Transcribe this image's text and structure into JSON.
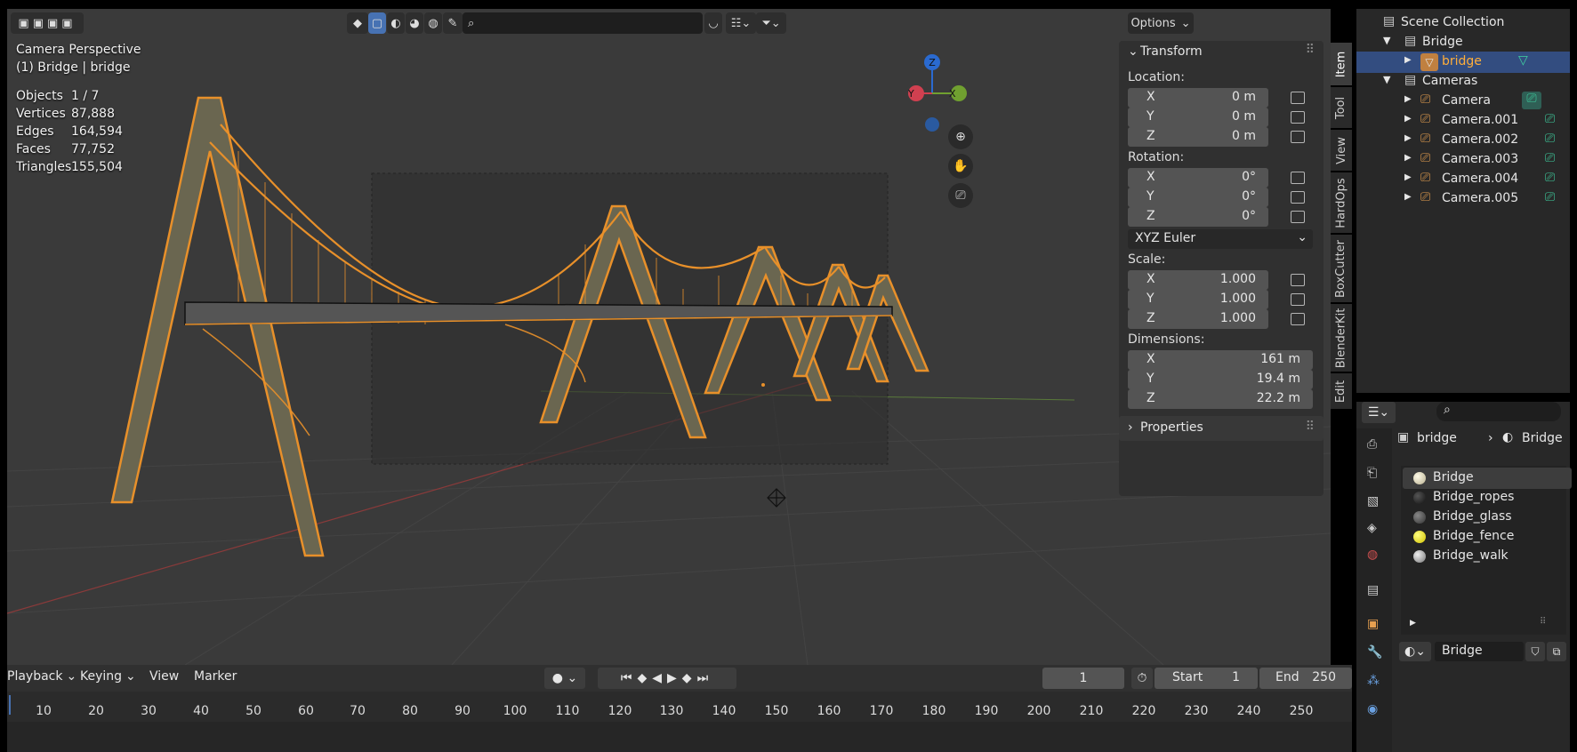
{
  "viewport": {
    "info_camera": "Camera Perspective",
    "info_object": "(1) Bridge | bridge",
    "stats": [
      {
        "label": "Objects",
        "value": "1 / 7"
      },
      {
        "label": "Vertices",
        "value": "87,888"
      },
      {
        "label": "Edges",
        "value": "164,594"
      },
      {
        "label": "Faces",
        "value": "77,752"
      },
      {
        "label": "Triangles",
        "value": "155,504"
      }
    ],
    "options_label": "Options",
    "search_placeholder": "",
    "gizmo": {
      "z": "Z",
      "x": "X",
      "y": "Y"
    }
  },
  "npanel": {
    "title": "Transform",
    "location_label": "Location:",
    "location": [
      {
        "axis": "X",
        "value": "0 m"
      },
      {
        "axis": "Y",
        "value": "0 m"
      },
      {
        "axis": "Z",
        "value": "0 m"
      }
    ],
    "rotation_label": "Rotation:",
    "rotation": [
      {
        "axis": "X",
        "value": "0°"
      },
      {
        "axis": "Y",
        "value": "0°"
      },
      {
        "axis": "Z",
        "value": "0°"
      }
    ],
    "rotation_mode": "XYZ Euler",
    "scale_label": "Scale:",
    "scale": [
      {
        "axis": "X",
        "value": "1.000"
      },
      {
        "axis": "Y",
        "value": "1.000"
      },
      {
        "axis": "Z",
        "value": "1.000"
      }
    ],
    "dimensions_label": "Dimensions:",
    "dimensions": [
      {
        "axis": "X",
        "value": "161 m"
      },
      {
        "axis": "Y",
        "value": "19.4 m"
      },
      {
        "axis": "Z",
        "value": "22.2 m"
      }
    ],
    "properties_label": "Properties"
  },
  "side_tabs": [
    "Item",
    "Tool",
    "View",
    "HardOps",
    "BoxCutter",
    "BlenderKit",
    "Edit"
  ],
  "outliner": {
    "root": "Scene Collection",
    "bridge_collection": "Bridge",
    "bridge_object": "bridge",
    "cameras_collection": "Cameras",
    "cameras": [
      "Camera",
      "Camera.001",
      "Camera.002",
      "Camera.003",
      "Camera.004",
      "Camera.005"
    ]
  },
  "properties": {
    "breadcrumb_object": "bridge",
    "breadcrumb_material": "Bridge",
    "materials": [
      {
        "name": "Bridge",
        "color": "#e8e0c0"
      },
      {
        "name": "Bridge_ropes",
        "color": "#202020"
      },
      {
        "name": "Bridge_glass",
        "color": "#505050"
      },
      {
        "name": "Bridge_fence",
        "color": "#f0e000"
      },
      {
        "name": "Bridge_walk",
        "color": "#b0b0b0"
      }
    ],
    "material_slot": "Bridge"
  },
  "timeline": {
    "menus": [
      "Playback",
      "Keying",
      "View",
      "Marker"
    ],
    "current_frame": "1",
    "start_label": "Start",
    "start_value": "1",
    "end_label": "End",
    "end_value": "250",
    "ticks": [
      "10",
      "20",
      "30",
      "40",
      "50",
      "60",
      "70",
      "80",
      "90",
      "100",
      "110",
      "120",
      "130",
      "140",
      "150",
      "160",
      "170",
      "180",
      "190",
      "200",
      "210",
      "220",
      "230",
      "240",
      "250"
    ]
  }
}
